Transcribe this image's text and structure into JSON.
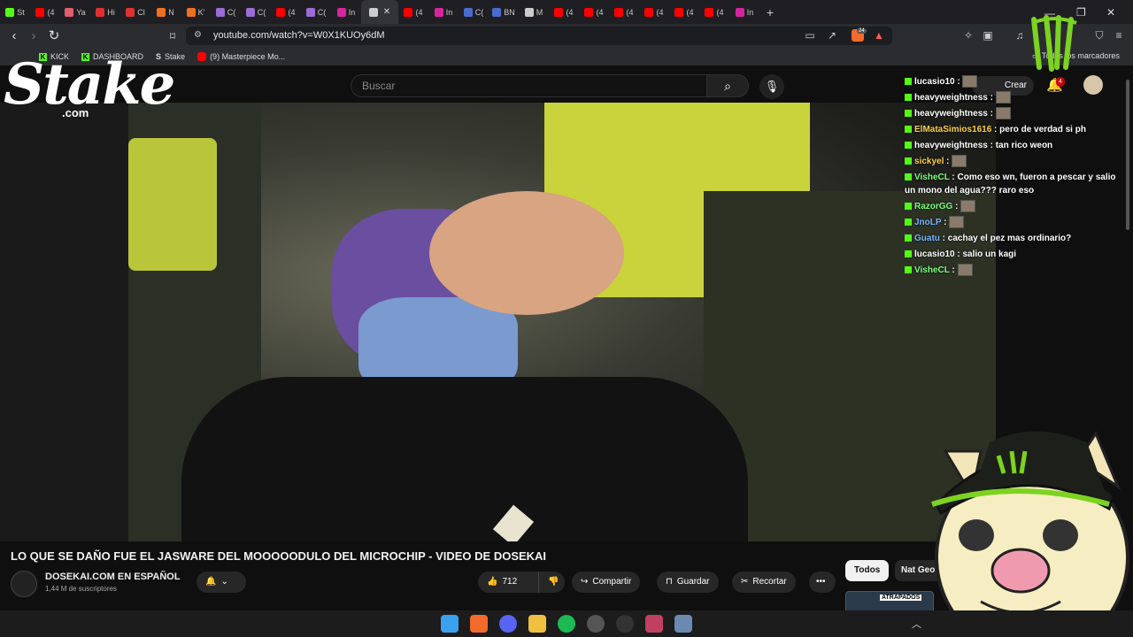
{
  "browser": {
    "tabs": [
      {
        "label": "St",
        "color": "#53fc18"
      },
      {
        "label": "(4",
        "color": "#ff0000"
      },
      {
        "label": "Ya",
        "color": "#e05d6f"
      },
      {
        "label": "Hi",
        "color": "#e03030"
      },
      {
        "label": "Cl",
        "color": "#e03030"
      },
      {
        "label": "N",
        "color": "#f07020"
      },
      {
        "label": "K'",
        "color": "#f07020"
      },
      {
        "label": "C(",
        "color": "#9b6bd6"
      },
      {
        "label": "C(",
        "color": "#9b6bd6"
      },
      {
        "label": "(4",
        "color": "#ff0000"
      },
      {
        "label": "C(",
        "color": "#9b6bd6"
      },
      {
        "label": "In",
        "color": "#d6249f"
      },
      {
        "label": "",
        "color": "#cccccc",
        "active": true
      },
      {
        "label": "(4",
        "color": "#ff0000"
      },
      {
        "label": "In",
        "color": "#d6249f"
      },
      {
        "label": "C(",
        "color": "#4a6ad0"
      },
      {
        "label": "BN",
        "color": "#4a6ad0"
      },
      {
        "label": "M",
        "color": "#cccccc"
      },
      {
        "label": "(4",
        "color": "#ff0000"
      },
      {
        "label": "(4",
        "color": "#ff0000"
      },
      {
        "label": "(4",
        "color": "#ff0000"
      },
      {
        "label": "(4",
        "color": "#ff0000"
      },
      {
        "label": "(4",
        "color": "#ff0000"
      },
      {
        "label": "(4",
        "color": "#ff0000"
      },
      {
        "label": "In",
        "color": "#d6249f"
      }
    ],
    "tab_close": "✕",
    "new_tab": "+",
    "url": "youtube.com/watch?v=W0X1KUOy6dM",
    "brave_badge": "24",
    "bookmarks": [
      {
        "label": "KICK",
        "icon": "kick"
      },
      {
        "label": "DASHBOARD",
        "icon": "kick"
      },
      {
        "label": "Stake",
        "icon": "stake"
      },
      {
        "label": "(9) Masterpiece Mo...",
        "icon": "youtube"
      }
    ],
    "all_bookmarks": "Todos los marcadores"
  },
  "youtube": {
    "search_placeholder": "Buscar",
    "create_label": "Crear",
    "notifications": "4",
    "video_title": "LO QUE SE DAÑO FUE EL JASWARE DEL MOOOOODULO DEL MICROCHIP - VIDEO DE DOSEKAI",
    "channel_name": "DOSEKAI.COM EN ESPAÑOL",
    "subscribers": "1,44 M de suscriptores",
    "likes": "712",
    "share": "Compartir",
    "save": "Guardar",
    "clip": "Recortar",
    "chips": [
      "Todos",
      "Nat Geo"
    ],
    "thumb_label": "ATRAPADOS"
  },
  "overlay": {
    "stake_word": "Stake",
    "stake_com": ".com"
  },
  "chat": [
    {
      "user": "lucasio10",
      "color": "#ffffff",
      "text": "",
      "emote": true
    },
    {
      "user": "heavyweightness",
      "color": "#ffffff",
      "text": "",
      "emote": true
    },
    {
      "user": "heavyweightness",
      "color": "#ffffff",
      "text": "",
      "emote": true
    },
    {
      "user": "ElMataSimios1616",
      "color": "#ffd24a",
      "text": "pero de verdad si ph",
      "emote": false
    },
    {
      "user": "heavyweightness",
      "color": "#ffffff",
      "text": "tan rico weon",
      "emote": false
    },
    {
      "user": "sickyel",
      "color": "#ffd24a",
      "text": "",
      "emote": true
    },
    {
      "user": "VisheCL",
      "color": "#7dff7d",
      "text": "Como eso wn, fueron a pescar y salio un mono del agua??? raro eso",
      "emote": false
    },
    {
      "user": "RazorGG",
      "color": "#7dff7d",
      "text": "",
      "emote": true
    },
    {
      "user": "JnoLP",
      "color": "#7ab8ff",
      "text": "",
      "emote": true
    },
    {
      "user": "Guatu",
      "color": "#7ab8ff",
      "text": "cachay el pez mas ordinario?",
      "emote": false
    },
    {
      "user": "lucasio10",
      "color": "#ffffff",
      "text": "salio un kagi",
      "emote": false
    },
    {
      "user": "VisheCL",
      "color": "#7dff7d",
      "text": "",
      "emote": true
    }
  ]
}
